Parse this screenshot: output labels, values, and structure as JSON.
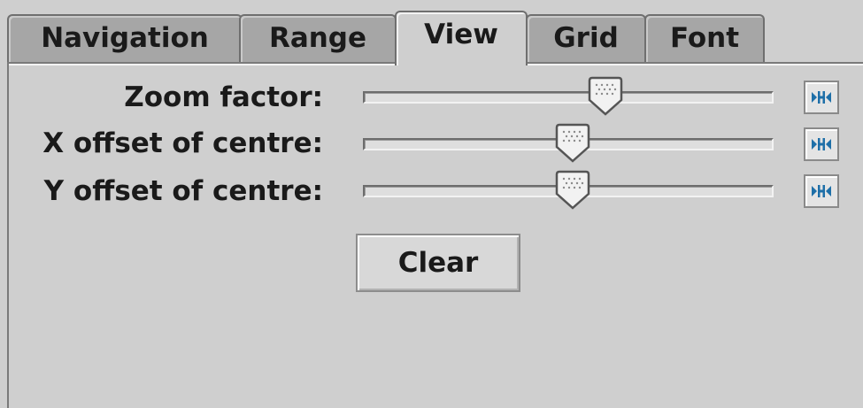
{
  "tabs": [
    {
      "label": "Navigation",
      "selected": false
    },
    {
      "label": "Range",
      "selected": false
    },
    {
      "label": "View",
      "selected": true
    },
    {
      "label": "Grid",
      "selected": false
    },
    {
      "label": "Font",
      "selected": false
    }
  ],
  "view": {
    "rows": [
      {
        "label": "Zoom factor:",
        "slider_fraction": 0.59,
        "reset_icon": "reset-centre-icon"
      },
      {
        "label": "X offset of centre:",
        "slider_fraction": 0.51,
        "reset_icon": "reset-centre-icon"
      },
      {
        "label": "Y offset of centre:",
        "slider_fraction": 0.51,
        "reset_icon": "reset-centre-icon"
      }
    ],
    "clear_label": "Clear"
  },
  "colors": {
    "reset_icon": "#1e6fa8",
    "thumb_fill": "#f2f2f2",
    "thumb_stroke": "#555555"
  }
}
